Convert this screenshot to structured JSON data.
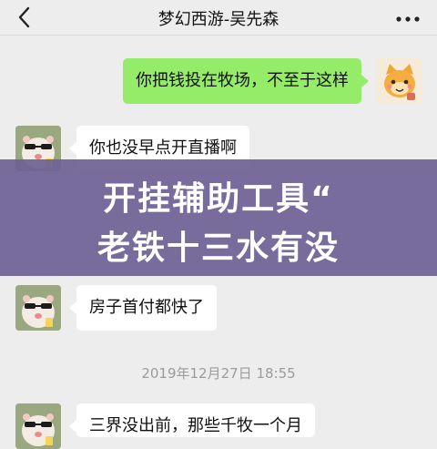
{
  "header": {
    "title": "梦幻西游-吴先森"
  },
  "messages": [
    {
      "side": "me",
      "text": "你把钱投在牧场，不至于这样"
    },
    {
      "side": "other",
      "text": "你也没早点开直播啊"
    },
    {
      "side": "other",
      "text": "房子首付都快了"
    },
    {
      "side": "other",
      "text": "三界没出前，那些千牧一个月"
    }
  ],
  "timestamp": "2019年12月27日 18:55",
  "overlay_banner": {
    "line1": "开挂辅助工具“",
    "line2": "老铁十三水有没"
  },
  "colors": {
    "background": "#ededed",
    "bubble_me": "#95ec69",
    "bubble_other": "#ffffff",
    "banner": "#6e6296"
  },
  "icons": {
    "back": "chevron-left-icon",
    "more": "more-dots-icon",
    "avatar_me": "cartoon-cat-avatar",
    "avatar_other": "hamster-sunglasses-avatar"
  }
}
